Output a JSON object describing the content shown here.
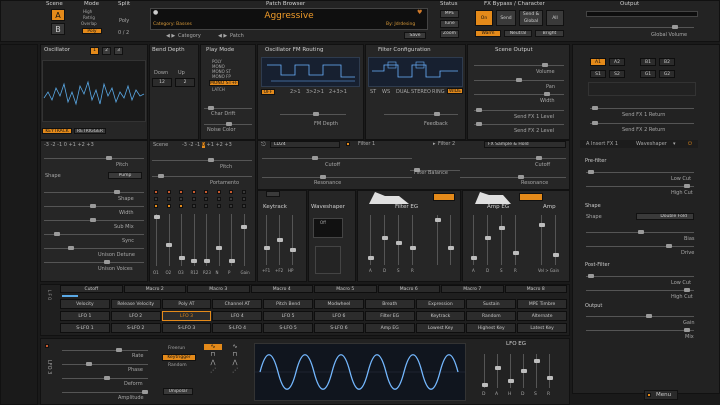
{
  "top": {
    "scene_label": "Scene",
    "scene_a": "A",
    "scene_b": "B",
    "mode_label": "Mode",
    "mode_options": [
      "High",
      "Retrig",
      "Overlap",
      "Poly"
    ],
    "split_label": "Split",
    "split_value": "Poly",
    "split_pages": "0 / 2",
    "patch_browser_label": "Patch Browser",
    "patch_name": "Aggressive",
    "patch_category": "Category: Basses",
    "patch_author": "By: Jdrdesing",
    "category_nav": "Category",
    "patch_nav": "Patch",
    "save_label": "Save",
    "status_label": "Status",
    "status_mpe": "MPE",
    "status_tune": "Tune",
    "status_zoom": "Zoom",
    "fx_bypass_label": "FX Bypass / Character",
    "fx_on": "On",
    "fx_send": "Send",
    "fx_send_global": "Send & Global",
    "fx_all": "All",
    "character_warm": "Warm",
    "character_neutral": "Neutral",
    "character_bright": "Bright",
    "output_label": "Output",
    "global_volume": "Global Volume"
  },
  "oscillator": {
    "title": "Oscillator",
    "tabs": [
      "1",
      "2",
      "3"
    ],
    "keytrack": "KEYTRACK",
    "retrigger": "RETRIGGER",
    "octave_row": "-3 -2 -1 0 +1 +2 +3",
    "wave_label": "Wave",
    "pitch": "Pitch",
    "shape": "Shape",
    "shape_value": "Pump",
    "sliders": [
      "Shape",
      "Width",
      "Sub Mix",
      "Sync",
      "Unison Detune",
      "Unison Voices"
    ],
    "unison_voices": "8 v"
  },
  "bend": {
    "title": "Bend Depth",
    "down": "Down",
    "up": "Up",
    "down_val": "12",
    "up_val": "2"
  },
  "play_mode": {
    "title": "Play Mode",
    "options": [
      "POLY",
      "MONO",
      "MONO ST",
      "MONO FP",
      "MONO ST+FP",
      "LATCH"
    ],
    "char_drift": "Char Drift",
    "noise_color": "Noise Color"
  },
  "fm_routing": {
    "title": "Oscillator FM Routing",
    "options": [
      "OFF",
      "2>1",
      "3>2>1",
      "2+3>1"
    ],
    "fm_depth": "FM Depth"
  },
  "filter_config": {
    "title": "Filter Configuration",
    "options": [
      "ST",
      "WS",
      "DUAL",
      "STEREO",
      "RING",
      "WIDE"
    ],
    "feedback": "Feedback"
  },
  "scene_output": {
    "title": "Scene Output",
    "volume": "Volume",
    "pan": "Pan",
    "width": "Width",
    "send1": "Send FX 1 Level",
    "send2": "Send FX 2 Level"
  },
  "fx_grid": {
    "slots": [
      "A1",
      "A2",
      "B1",
      "B2",
      "S1",
      "S2",
      "G1",
      "G2"
    ],
    "send1_return": "Send FX 1 Return",
    "send2_return": "Send FX 2 Return",
    "fx_unit": "A Insert FX 1",
    "fx_type": "Waveshaper",
    "prefilter": "Pre-filter",
    "low_cut": "Low Cut",
    "high_cut": "High Cut",
    "shape_section": "Shape",
    "shape_label": "Shape",
    "shape_value": "Double Fold",
    "bias": "Bias",
    "drive": "Drive",
    "postfilter": "Post-Filter",
    "low_cut2": "Low Cut",
    "high_cut2": "High Cut",
    "output": "Output",
    "gain": "Gain",
    "mix": "Mix"
  },
  "mixer": {
    "channels": [
      "O1",
      "O2",
      "O3",
      "R12",
      "R23",
      "N",
      "P",
      "Gain"
    ],
    "scene_row": "Scene",
    "pitch": "Pitch",
    "portamento": "Portamento"
  },
  "filters": {
    "filter1_name": "Filter 1",
    "filter1_type": "LD24",
    "filter2_name": "Filter 2",
    "filter2_type": "FX Sample & Hold",
    "cutoff": "Cutoff",
    "resonance": "Resonance",
    "balance": "Filter Balance",
    "cutoff2": "Cutoff",
    "resonance2": "Resonance",
    "keytrack": "Keytrack",
    "waveshaper": "Waveshaper",
    "ws_type": "Off",
    "filter_eg": "Filter EG",
    "amp_eg": "Amp EG",
    "amp": "Amp",
    "keytrack_sliders": [
      "+F1",
      "+F2",
      "HP"
    ],
    "env_sliders": [
      "A",
      "D",
      "S",
      "R"
    ],
    "amp_sliders": [
      "Vel > Gain"
    ]
  },
  "modulation": {
    "macros": [
      "Cutoff",
      "Macro 2",
      "Macro 3",
      "Macro 4",
      "Macro 5",
      "Macro 6",
      "Macro 7",
      "Macro 8"
    ],
    "row1": [
      "Velocity",
      "Release Velocity",
      "Poly AT",
      "Channel AT",
      "Pitch Bend",
      "Modwheel",
      "Breath",
      "Expression",
      "Sustain",
      "MPE Timbre"
    ],
    "row2": [
      "LFO 1",
      "LFO 2",
      "LFO 3",
      "LFO 4",
      "LFO 5",
      "LFO 6",
      "Filter EG",
      "Keytrack",
      "Random",
      "Alternate"
    ],
    "row3": [
      "S-LFO 1",
      "S-LFO 2",
      "S-LFO 3",
      "S-LFO 4",
      "S-LFO 5",
      "S-LFO 6",
      "Amp EG",
      "Lowest Key",
      "Highest Key",
      "Latest Key"
    ]
  },
  "lfo": {
    "title": "LFO 3",
    "sliders": [
      "Rate",
      "Phase",
      "Deform",
      "Amplitude"
    ],
    "mode_options": [
      "Freerun",
      "Keytrigger",
      "Random"
    ],
    "unipolar": "Unipolar",
    "eg_title": "LFO EG",
    "eg_sliders": [
      "D",
      "A",
      "H",
      "D",
      "S",
      "R"
    ],
    "menu": "Menu"
  }
}
